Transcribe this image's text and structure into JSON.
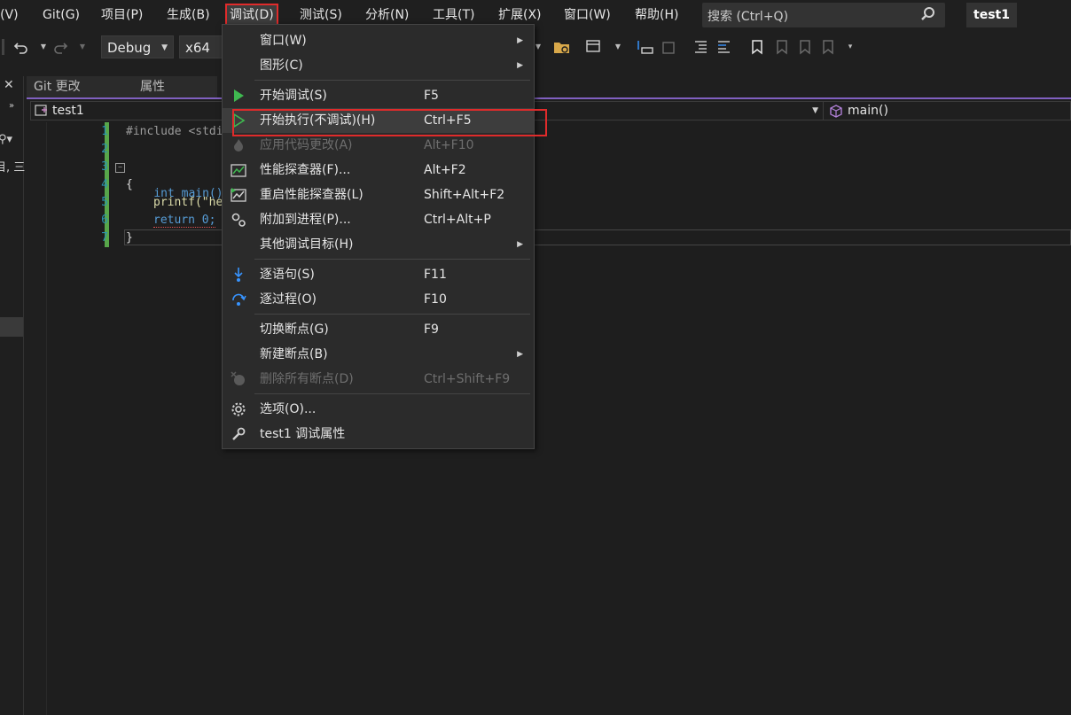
{
  "menubar": {
    "items": [
      {
        "label": "J(V)"
      },
      {
        "label": "Git(G)"
      },
      {
        "label": "项目(P)"
      },
      {
        "label": "生成(B)"
      },
      {
        "label": "调试(D)"
      },
      {
        "label": "测试(S)"
      },
      {
        "label": "分析(N)"
      },
      {
        "label": "工具(T)"
      },
      {
        "label": "扩展(X)"
      },
      {
        "label": "窗口(W)"
      },
      {
        "label": "帮助(H)"
      }
    ],
    "search_placeholder": "搜索 (Ctrl+Q)",
    "solution_name": "test1"
  },
  "toolbar": {
    "configuration": "Debug",
    "platform": "x64"
  },
  "left_strip": {
    "fragment": "目, 三"
  },
  "tabs": [
    {
      "label": "Git 更改"
    },
    {
      "label": "属性"
    }
  ],
  "navbar": {
    "project": "test1",
    "member": "main()"
  },
  "editor": {
    "lines": [
      {
        "no": "1",
        "text": "#include <stdi"
      },
      {
        "no": "2",
        "text": ""
      },
      {
        "no": "3",
        "text": "int main()"
      },
      {
        "no": "4",
        "text": "{"
      },
      {
        "no": "5",
        "text": "printf(\"he"
      },
      {
        "no": "6",
        "text": "return 0;"
      },
      {
        "no": "7",
        "text": "}"
      }
    ]
  },
  "debug_menu": {
    "items": [
      {
        "label": "窗口(W)",
        "shortcut": "",
        "submenu": true
      },
      {
        "label": "图形(C)",
        "shortcut": "",
        "submenu": true
      },
      {
        "label": "开始调试(S)",
        "shortcut": "F5"
      },
      {
        "label": "开始执行(不调试)(H)",
        "shortcut": "Ctrl+F5"
      },
      {
        "label": "应用代码更改(A)",
        "shortcut": "Alt+F10",
        "disabled": true
      },
      {
        "label": "性能探查器(F)...",
        "shortcut": "Alt+F2"
      },
      {
        "label": "重启性能探查器(L)",
        "shortcut": "Shift+Alt+F2"
      },
      {
        "label": "附加到进程(P)...",
        "shortcut": "Ctrl+Alt+P"
      },
      {
        "label": "其他调试目标(H)",
        "shortcut": "",
        "submenu": true
      },
      {
        "label": "逐语句(S)",
        "shortcut": "F11"
      },
      {
        "label": "逐过程(O)",
        "shortcut": "F10"
      },
      {
        "label": "切换断点(G)",
        "shortcut": "F9"
      },
      {
        "label": "新建断点(B)",
        "shortcut": "",
        "submenu": true
      },
      {
        "label": "删除所有断点(D)",
        "shortcut": "Ctrl+Shift+F9",
        "disabled": true
      },
      {
        "label": "选项(O)...",
        "shortcut": ""
      },
      {
        "label": "test1 调试属性",
        "shortcut": ""
      }
    ]
  },
  "colors": {
    "accent_purple": "#8060c0",
    "highlight_red": "#e02b2b",
    "play_green": "#3fb950",
    "step_blue": "#3794ff"
  }
}
